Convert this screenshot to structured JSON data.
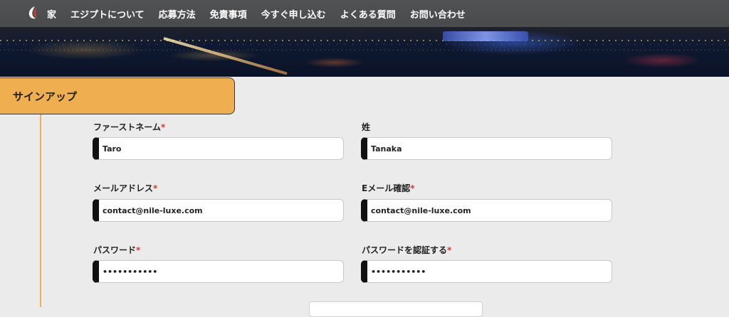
{
  "nav": {
    "items": [
      "家",
      "エジプトについて",
      "応募方法",
      "免責事項",
      "今すぐ申し込む",
      "よくある質問",
      "お問い合わせ"
    ]
  },
  "section": {
    "title": "サインアップ"
  },
  "form": {
    "first_name": {
      "label": "ファーストネーム",
      "required": "*",
      "value": "Taro"
    },
    "last_name": {
      "label": "姓",
      "value": "Tanaka"
    },
    "email": {
      "label": "メールアドレス",
      "required": "*",
      "value": "contact@nile-luxe.com"
    },
    "email_confirm": {
      "label": "Eメール確認",
      "required": "*",
      "value": "contact@nile-luxe.com"
    },
    "password": {
      "label": "パスワード",
      "required": "*",
      "value": "•••••••••••"
    },
    "password_confirm": {
      "label": "パスワードを認証する",
      "required": "*",
      "value": "•••••••••••"
    }
  },
  "colors": {
    "accent": "#efae50",
    "required": "#d23b2b",
    "nav_bg": "#5a5a5a",
    "page_bg": "#ebebeb"
  }
}
